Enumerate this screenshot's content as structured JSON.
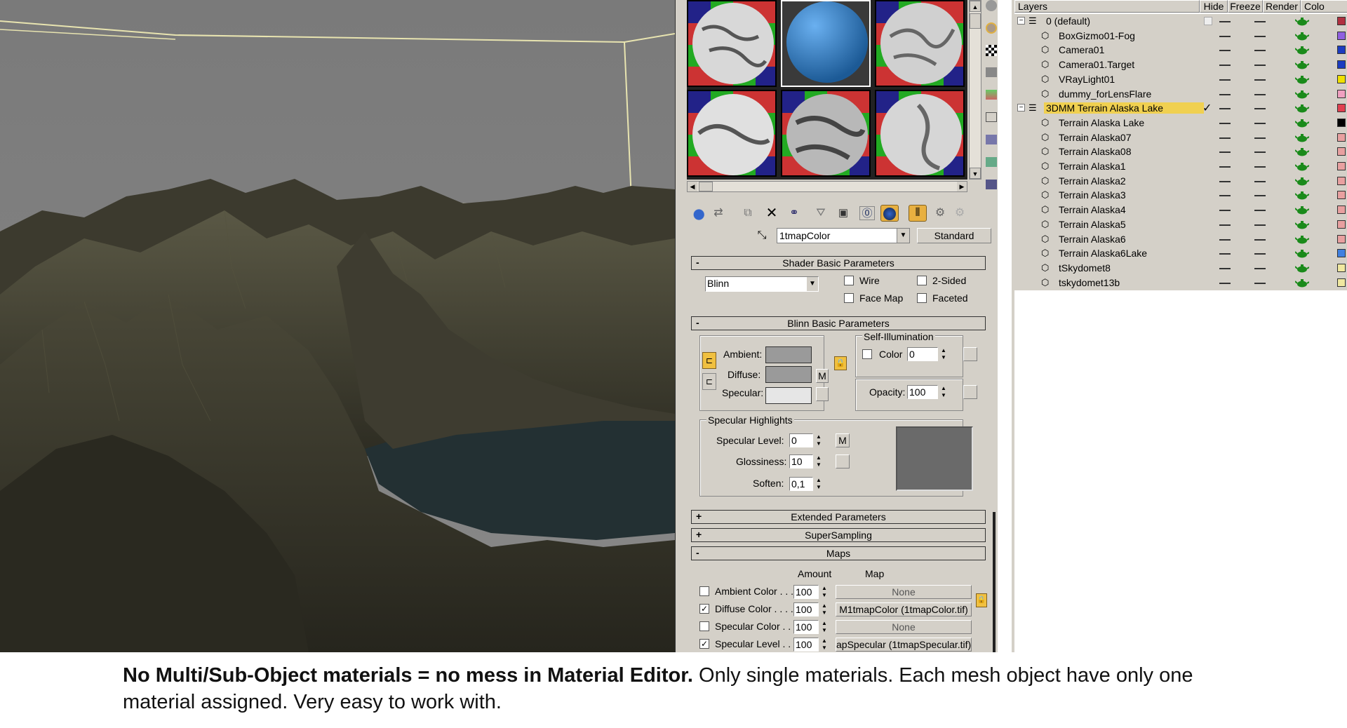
{
  "viewport": {
    "label": "3D viewport – Alaska terrain scene"
  },
  "material_editor": {
    "material_name": "1tmapColor",
    "material_type": "Standard",
    "rollouts": {
      "shader_basic": "Shader Basic Parameters",
      "blinn_basic": "Blinn Basic Parameters",
      "extended": "Extended Parameters",
      "supersampling": "SuperSampling",
      "maps": "Maps"
    },
    "shader": {
      "selected": "Blinn",
      "wire": "Wire",
      "two_sided": "2-Sided",
      "face_map": "Face Map",
      "faceted": "Faceted"
    },
    "blinn": {
      "ambient": "Ambient:",
      "diffuse": "Diffuse:",
      "specular": "Specular:",
      "m": "M",
      "self_illum_title": "Self-Illumination",
      "color_label": "Color",
      "color_value": "0",
      "opacity_label": "Opacity:",
      "opacity_value": "100",
      "spec_highlights": "Specular Highlights",
      "spec_level_label": "Specular Level:",
      "spec_level_value": "0",
      "gloss_label": "Glossiness:",
      "gloss_value": "10",
      "soften_label": "Soften:",
      "soften_value": "0,1"
    },
    "maps": {
      "amount_header": "Amount",
      "map_header": "Map",
      "rows": [
        {
          "label": "Ambient Color . . .",
          "checked": false,
          "amount": "100",
          "map": "None"
        },
        {
          "label": "Diffuse Color . . . .",
          "checked": true,
          "amount": "100",
          "map": "M1tmapColor (1tmapColor.tif)"
        },
        {
          "label": "Specular Color . .",
          "checked": false,
          "amount": "100",
          "map": "None"
        },
        {
          "label": "Specular Level . .",
          "checked": true,
          "amount": "100",
          "map": "apSpecular (1tmapSpecular.tif)"
        }
      ]
    }
  },
  "layers": {
    "headers": {
      "layers": "Layers",
      "hide": "Hide",
      "freeze": "Freeze",
      "render": "Render",
      "color": "Colo"
    },
    "rows": [
      {
        "name": "0 (default)",
        "level": 0,
        "color": "#b03040",
        "highlight": false,
        "checked": false
      },
      {
        "name": "BoxGizmo01-Fog",
        "level": 1,
        "color": "#9060e0",
        "highlight": false,
        "checked": false
      },
      {
        "name": "Camera01",
        "level": 1,
        "color": "#1c3cc0",
        "highlight": false,
        "checked": false
      },
      {
        "name": "Camera01.Target",
        "level": 1,
        "color": "#1c3cc0",
        "highlight": false,
        "checked": false
      },
      {
        "name": "VRayLight01",
        "level": 1,
        "color": "#f0e000",
        "highlight": false,
        "checked": false
      },
      {
        "name": "dummy_forLensFlare",
        "level": 1,
        "color": "#f0a0c0",
        "highlight": false,
        "checked": false
      },
      {
        "name": "3DMM Terrain Alaska Lake",
        "level": 0,
        "color": "#e04050",
        "highlight": true,
        "checked": true
      },
      {
        "name": "Terrain Alaska Lake",
        "level": 1,
        "color": "#000000",
        "highlight": false,
        "checked": false
      },
      {
        "name": "Terrain Alaska07",
        "level": 1,
        "color": "#e8a0a0",
        "highlight": false,
        "checked": false
      },
      {
        "name": "Terrain Alaska08",
        "level": 1,
        "color": "#e8a0a0",
        "highlight": false,
        "checked": false
      },
      {
        "name": "Terrain Alaska1",
        "level": 1,
        "color": "#e8a0a0",
        "highlight": false,
        "checked": false
      },
      {
        "name": "Terrain Alaska2",
        "level": 1,
        "color": "#e8a0a0",
        "highlight": false,
        "checked": false
      },
      {
        "name": "Terrain Alaska3",
        "level": 1,
        "color": "#e8a0a0",
        "highlight": false,
        "checked": false
      },
      {
        "name": "Terrain Alaska4",
        "level": 1,
        "color": "#e8a0a0",
        "highlight": false,
        "checked": false
      },
      {
        "name": "Terrain Alaska5",
        "level": 1,
        "color": "#e8a0a0",
        "highlight": false,
        "checked": false
      },
      {
        "name": "Terrain Alaska6",
        "level": 1,
        "color": "#e8a0a0",
        "highlight": false,
        "checked": false
      },
      {
        "name": "Terrain Alaska6Lake",
        "level": 1,
        "color": "#4080e0",
        "highlight": false,
        "checked": false
      },
      {
        "name": "tSkydomet8",
        "level": 1,
        "color": "#f0e8a0",
        "highlight": false,
        "checked": false
      },
      {
        "name": "tskydomet13b",
        "level": 1,
        "color": "#f0e8a0",
        "highlight": false,
        "checked": false
      }
    ]
  },
  "caption": {
    "bold": "No Multi/Sub-Object materials = no mess in Material Editor.",
    "normal": " Only single materials. Each mesh object have only one material assigned. Very easy to work with."
  }
}
